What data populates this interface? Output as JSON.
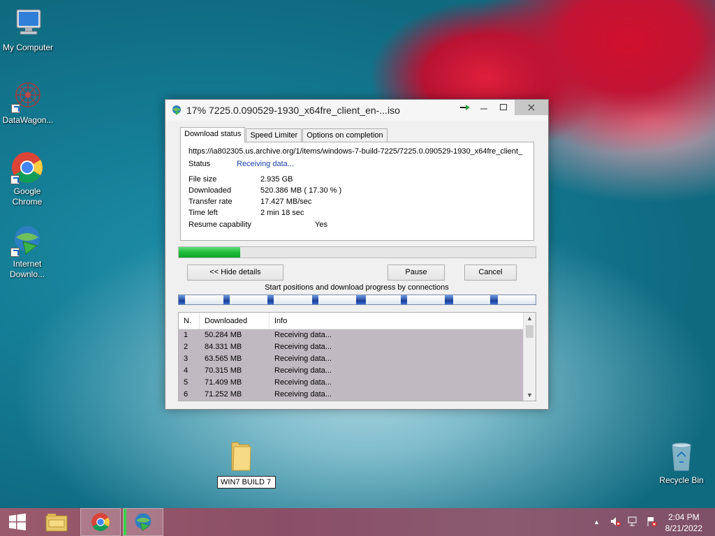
{
  "desktop": {
    "icons": [
      {
        "label": "My Computer"
      },
      {
        "label": "DataWagon..."
      },
      {
        "label": "Google Chrome"
      },
      {
        "label": "Internet Downlo..."
      },
      {
        "label": "Recycle Bin"
      }
    ],
    "folder_label": "WIN7 BUILD 7"
  },
  "window": {
    "title": "17% 7225.0.090529-1930_x64fre_client_en-...iso",
    "tabs": [
      "Download status",
      "Speed Limiter",
      "Options on completion"
    ],
    "url": "https://ia802305.us.archive.org/1/items/windows-7-build-7225/7225.0.090529-1930_x64fre_client_",
    "status_label": "Status",
    "status_value": "Receiving data...",
    "file_size_label": "File size",
    "file_size_value": "2.935  GB",
    "downloaded_label": "Downloaded",
    "downloaded_value": "520.386  MB  ( 17.30 % )",
    "transfer_rate_label": "Transfer rate",
    "transfer_rate_value": "17.427  MB/sec",
    "time_left_label": "Time left",
    "time_left_value": "2 min 18 sec",
    "resume_label": "Resume capability",
    "resume_value": "Yes",
    "progress_fraction": 0.173,
    "hide_details_label": "<< Hide details",
    "pause_label": "Pause",
    "cancel_label": "Cancel",
    "connections_label": "Start positions and download progress by connections",
    "columns": [
      "N.",
      "Downloaded",
      "Info"
    ],
    "rows": [
      {
        "n": "1",
        "downloaded": "50.284  MB",
        "info": "Receiving data..."
      },
      {
        "n": "2",
        "downloaded": "84.331  MB",
        "info": "Receiving data..."
      },
      {
        "n": "3",
        "downloaded": "63.565  MB",
        "info": "Receiving data..."
      },
      {
        "n": "4",
        "downloaded": "70.315  MB",
        "info": "Receiving data..."
      },
      {
        "n": "5",
        "downloaded": "71.409  MB",
        "info": "Receiving data..."
      },
      {
        "n": "6",
        "downloaded": "71.252  MB",
        "info": "Receiving data..."
      }
    ]
  },
  "taskbar": {
    "time": "2:04 PM",
    "date": "8/21/2022"
  },
  "colors": {
    "progress_green": "#1fbb3a",
    "status_blue": "#1a3fa8",
    "taskbar": "#8a4f66"
  }
}
